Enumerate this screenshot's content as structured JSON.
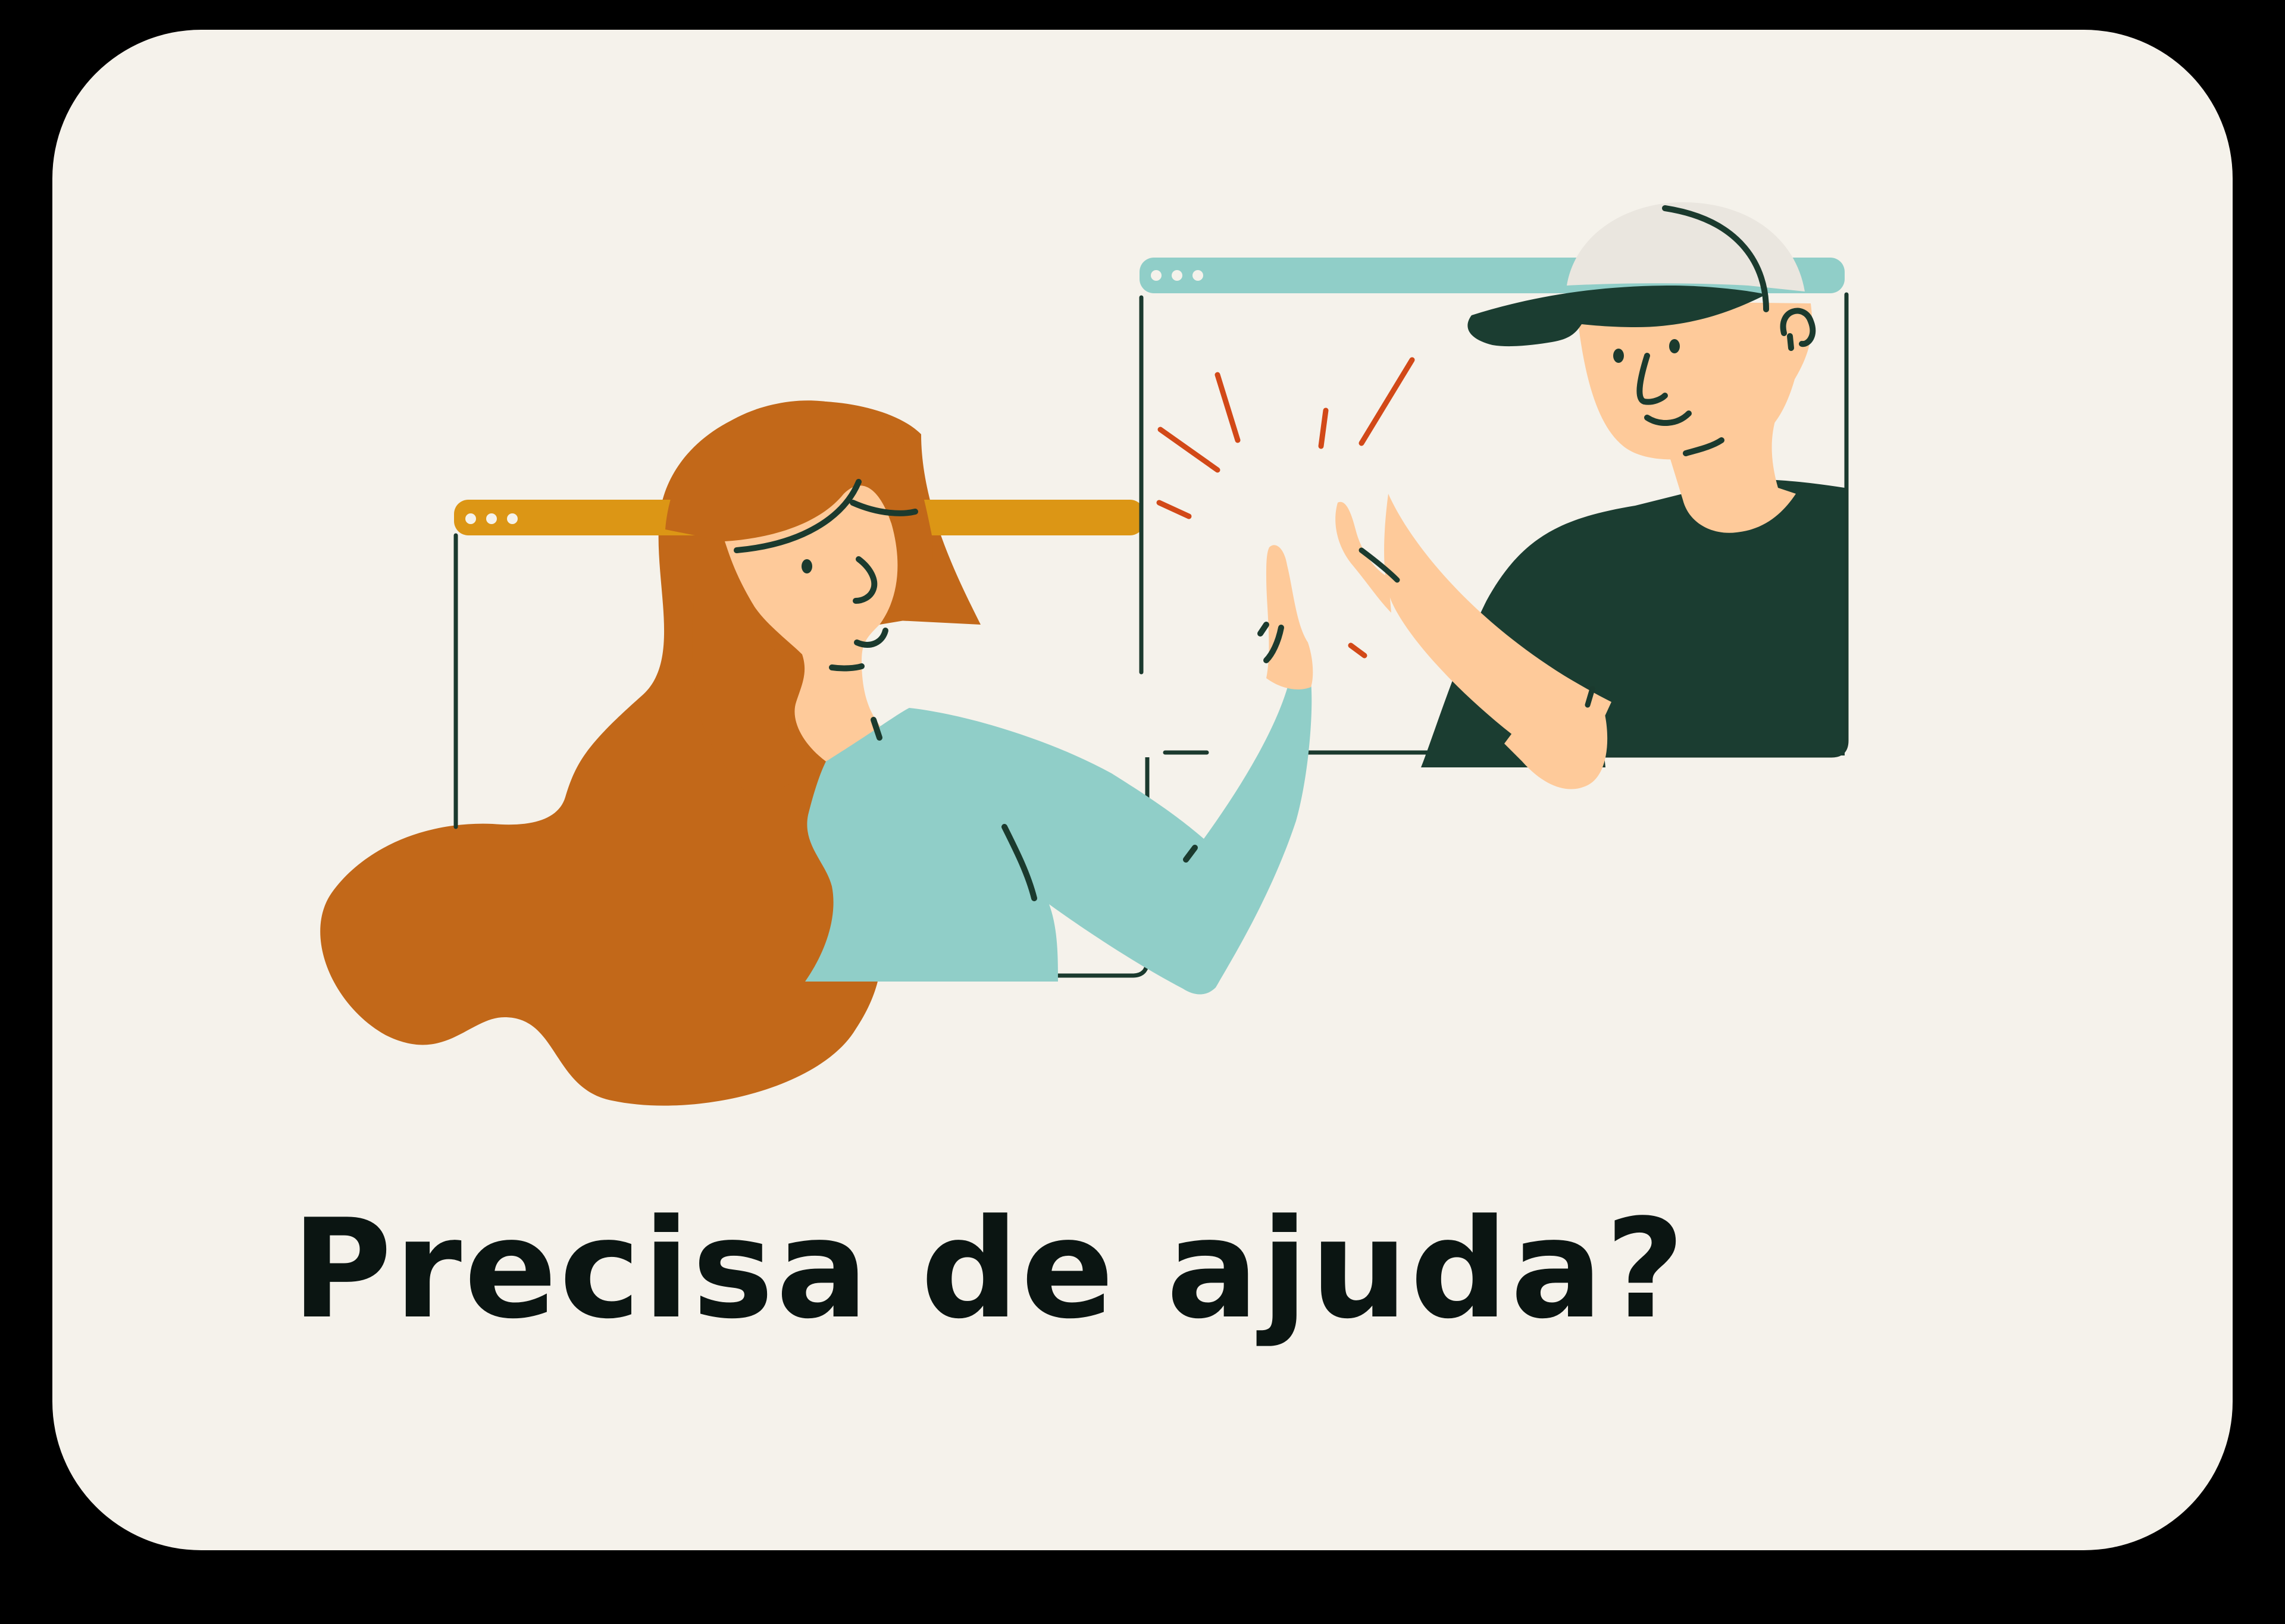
{
  "card": {
    "title": "Precisa de ajuda?"
  },
  "colors": {
    "page_background": "#000000",
    "card_background": "#F5F2EB",
    "heading_text": "#0B1512",
    "window_bar_left": "#DC9615",
    "window_bar_right": "#90CEC8",
    "outline": "#1B3A2E",
    "hair": "#C26819",
    "skin": "#FECA9A",
    "woman_sweater": "#90CEC8",
    "man_shirt": "#1B3D31",
    "cap": "#EAE6DF",
    "sparkle": "#D24918"
  },
  "illustration": {
    "icon": "video-call-high-five-illustration",
    "left_window_icon": "browser-window-icon",
    "right_window_icon": "browser-window-icon"
  }
}
